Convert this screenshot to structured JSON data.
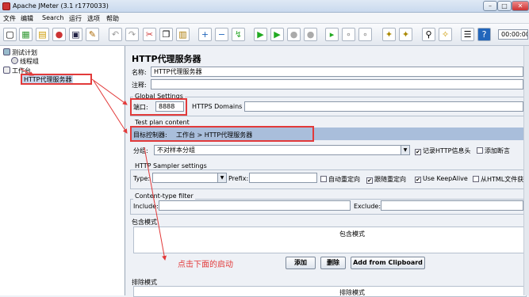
{
  "title": "Apache JMeter (3.1 r1770033)",
  "window_buttons": [
    "–",
    "□",
    "✕"
  ],
  "menu": [
    "文件",
    "编辑",
    "Search",
    "运行",
    "选项",
    "帮助"
  ],
  "timer": "00:00:00",
  "tree": [
    "测试计划",
    "线程组",
    "工作台",
    "HTTP代理服务器"
  ],
  "panel": {
    "heading": "HTTP代理服务器",
    "name_label": "名称:",
    "name_value": "HTTP代理服务器",
    "comment_label": "注释:",
    "global": "Global Settings",
    "port_label": "端口:",
    "port_value": "8888",
    "https_label": "HTTPS Domains :",
    "plan": "Test plan content",
    "target_label": "目标控制器:",
    "target_value": "工作台 > HTTP代理服务器",
    "group_label": "分组:",
    "group_value": "不对样本分组",
    "record_headers": "记录HTTP信息头",
    "add_assert": "添加断言",
    "sampler": "HTTP Sampler settings",
    "type_label": "Type:",
    "prefix_label": "Prefix:",
    "redirect": "自动重定向",
    "follow": "跟随重定向",
    "keepalive": "Use KeepAlive",
    "html": "从HTML文件获取",
    "content": "Content-type filter",
    "include_label": "Include:",
    "exclude_label": "Exclude:",
    "include_pattern": "包含模式",
    "include_header": "包含模式",
    "add_btn": "添加",
    "del_btn": "删除",
    "clip_btn": "Add from Clipboard",
    "exclude_pattern": "排除模式",
    "exclude_header": "排除模式"
  },
  "annotation": "点击下面的启动",
  "colors": {
    "annotation": "#e23a3a",
    "target_bg": "#a9bedb"
  }
}
